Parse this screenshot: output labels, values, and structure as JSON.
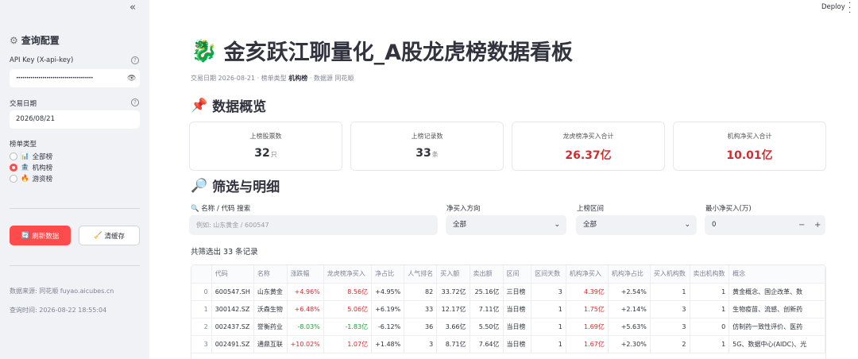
{
  "sidebar": {
    "collapse_icon": "«",
    "title": "查询配置",
    "api_key_label": "API Key (X-api-key)",
    "api_key_value": "••••••••••••••••••••••••••••••••••••••",
    "date_label": "交易日期",
    "date_value": "2026/08/21",
    "list_type_label": "榜单类型",
    "options": [
      {
        "icon": "📊",
        "label": "全部榜",
        "selected": false
      },
      {
        "icon": "🏦",
        "label": "机构榜",
        "selected": true
      },
      {
        "icon": "🔥",
        "label": "游资榜",
        "selected": false
      }
    ],
    "refresh_icon": "🔄",
    "refresh_label": "刷新数据",
    "clear_icon": "🧹",
    "clear_label": "清缓存",
    "source_text": "数据来源: 同花顺 fuyao.aicubes.cn",
    "query_time_text": "查询时间: 2026-08-22 18:55:04"
  },
  "header": {
    "deploy_label": "Deploy"
  },
  "main": {
    "title_icon": "🐉",
    "title": "金亥跃江聊量化_A股龙虎榜数据看板",
    "caption_date_label": "交易日期 ",
    "caption_date": "2026-08-21",
    "caption_sep1": " · 榜单类型 ",
    "caption_type": "机构榜",
    "caption_sep2": " · 数据源 同花顺",
    "overview_icon": "📌",
    "overview_title": "数据概览",
    "metrics": [
      {
        "label": "上榜股票数",
        "value": "32",
        "unit": "只",
        "red": false
      },
      {
        "label": "上榜记录数",
        "value": "33",
        "unit": "条",
        "red": false
      },
      {
        "label": "龙虎榜净买入合计",
        "value": "26.37亿",
        "unit": "",
        "red": true
      },
      {
        "label": "机构净买入合计",
        "value": "10.01亿",
        "unit": "",
        "red": true
      }
    ],
    "filter_icon": "🔎",
    "filter_title": "筛选与明细",
    "search_label": "🔍 名称 / 代码 搜索",
    "search_placeholder": "例如: 山东黄金 / 600547",
    "direction_label": "净买入方向",
    "direction_value": "全部",
    "interval_label": "上榜区间",
    "interval_value": "全部",
    "min_net_label": "最小净买入(万)",
    "min_net_value": "0",
    "count_text": "共筛选出 33 条记录"
  },
  "table": {
    "columns": [
      "",
      "代码",
      "名称",
      "涨跌幅",
      "龙虎榜净买入",
      "净占比",
      "人气排名",
      "买入额",
      "卖出额",
      "区间",
      "区间天数",
      "机构净买入",
      "机构净占比",
      "买入机构数",
      "卖出机构数",
      "概念"
    ],
    "rows": [
      [
        "0",
        "600547.SH",
        "山东黄金",
        "+4.96%",
        "8.56亿",
        "+4.95%",
        "82",
        "33.72亿",
        "25.16亿",
        "三日榜",
        "3",
        "4.39亿",
        "+2.54%",
        "1",
        "1",
        "黄金概念、国企改革、数"
      ],
      [
        "1",
        "300142.SZ",
        "沃森生物",
        "+6.48%",
        "5.06亿",
        "+6.19%",
        "33",
        "12.17亿",
        "7.11亿",
        "当日榜",
        "1",
        "1.75亿",
        "+2.14%",
        "3",
        "1",
        "生物疫苗、流感、创新药"
      ],
      [
        "2",
        "002437.SZ",
        "誉衡药业",
        "-8.03%",
        "-1.83亿",
        "-6.12%",
        "36",
        "3.66亿",
        "5.50亿",
        "当日榜",
        "1",
        "1.69亿",
        "+5.63%",
        "3",
        "0",
        "仿制药一致性评价、医药"
      ],
      [
        "3",
        "002491.SZ",
        "通鼎互联",
        "+10.02%",
        "1.07亿",
        "+1.48%",
        "3",
        "8.71亿",
        "7.64亿",
        "当日榜",
        "1",
        "1.67亿",
        "+2.30%",
        "2",
        "1",
        "5G、数据中心(AIDC)、光"
      ]
    ],
    "colors": {
      "up": "#d12d2d",
      "down": "#1f9d3a"
    }
  }
}
